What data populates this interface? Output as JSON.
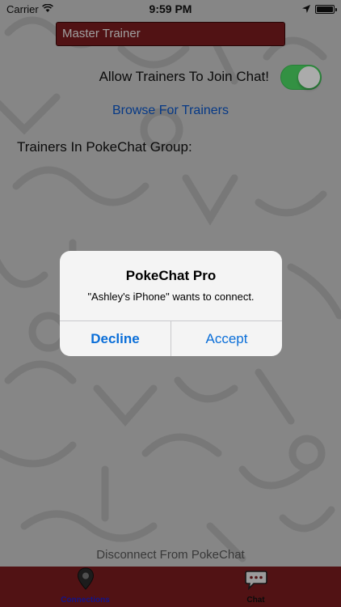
{
  "status_bar": {
    "carrier": "Carrier",
    "time": "9:59 PM"
  },
  "trainer_name": {
    "value": "Master Trainer"
  },
  "allow_join": {
    "label": "Allow Trainers To Join Chat!",
    "on": true
  },
  "browse_label": "Browse For Trainers",
  "group_label": "Trainers In PokeChat Group:",
  "disconnect_label": "Disconnect From PokeChat",
  "tabs": [
    {
      "label": "Connections",
      "icon": "location-pin-icon",
      "selected": true
    },
    {
      "label": "Chat",
      "icon": "chat-bubble-icon",
      "selected": false
    }
  ],
  "alert": {
    "title": "PokeChat Pro",
    "message": "\"Ashley's iPhone\" wants to connect.",
    "decline_label": "Decline",
    "accept_label": "Accept"
  },
  "colors": {
    "brand_red": "#7a1c1e",
    "toggle_on": "#4cd964",
    "link_blue": "#0a55c8",
    "alert_blue": "#0a6ed8"
  }
}
